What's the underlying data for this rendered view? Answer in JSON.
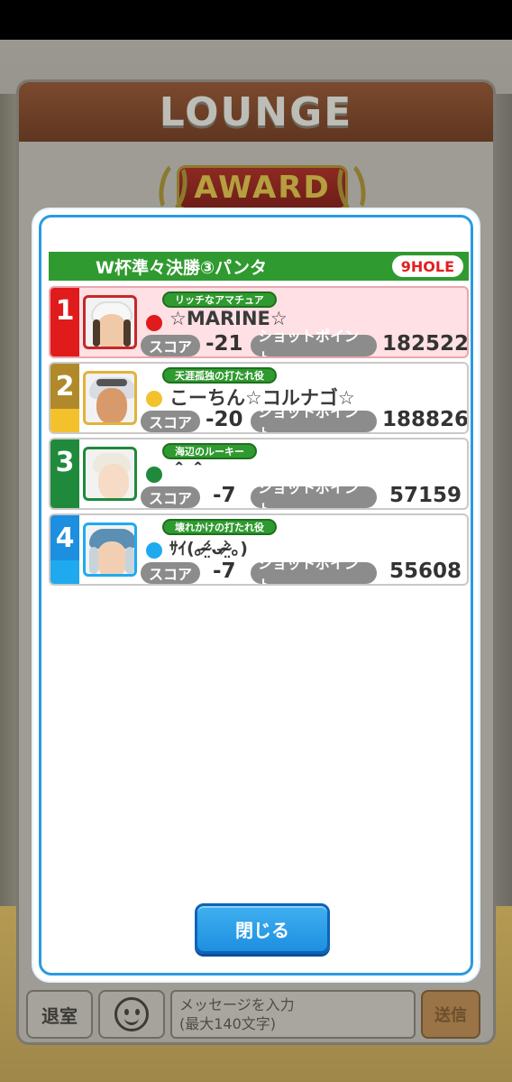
{
  "lounge": {
    "title": "LOUNGE",
    "award_label": "AWARD"
  },
  "chat": {
    "leave_label": "退室",
    "message_placeholder": "メッセージを入力\n(最大140文字)",
    "send_label": "送信"
  },
  "modal": {
    "course_name": "W杯準々決勝③パンタ",
    "hole_badge": "9HOLE",
    "score_label": "スコア",
    "shot_points_label": "ショットポイント",
    "close_label": "閉じる",
    "entries": [
      {
        "rank": "1",
        "title": "リッチなアマチュア",
        "name": "☆MARINE☆",
        "score": "-21",
        "points": "182522",
        "rank_color": "#e01b1b",
        "dot_color": "#e01b1b"
      },
      {
        "rank": "2",
        "title": "天涯孤独の打たれ役",
        "name": "こーちん☆コルナゴ☆",
        "score": "-20",
        "points": "188826",
        "rank_color": "#b08a2a",
        "dot_color": "#f3c12c"
      },
      {
        "rank": "3",
        "title": "海辺のルーキー",
        "name": "＾＾",
        "score": "-7",
        "points": "57159",
        "rank_color": "#1f8a3c",
        "dot_color": "#1f8a3c"
      },
      {
        "rank": "4",
        "title": "壊れかけの打たれ役",
        "name": "ｻｲ(｡ᵔ̴̶̷̤́ᴗᵔ̴̶̷̤̀｡)",
        "score": "-7",
        "points": "55608",
        "rank_color": "#1d8fe0",
        "dot_color": "#1faaf0"
      }
    ]
  }
}
